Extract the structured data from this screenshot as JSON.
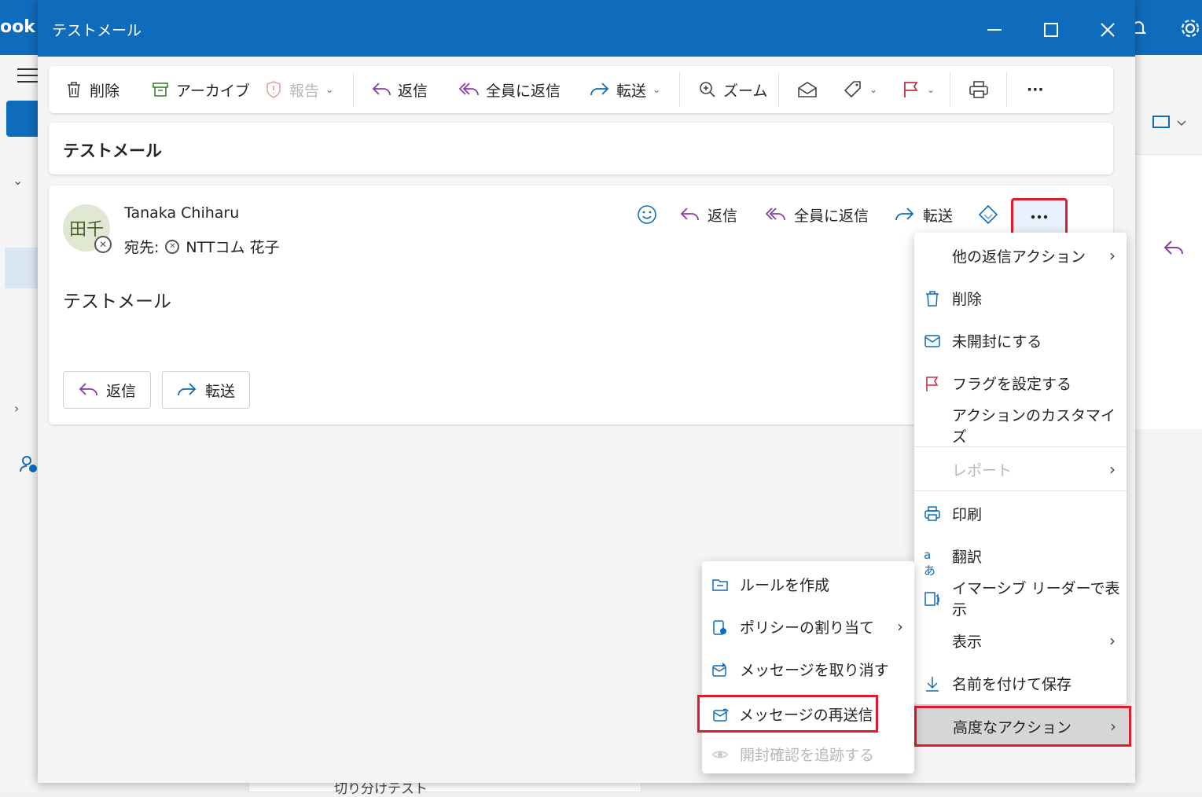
{
  "background": {
    "brand": "ook",
    "bottom_item": "切り分けテスト"
  },
  "window": {
    "title": "テストメール"
  },
  "toolbar": {
    "delete": "削除",
    "archive": "アーカイブ",
    "report": "報告",
    "reply": "返信",
    "reply_all": "全員に返信",
    "forward": "転送",
    "zoom": "ズーム",
    "more": "···"
  },
  "message": {
    "subject": "テストメール",
    "avatar_initials": "田千",
    "sender": "Tanaka Chiharu",
    "to_label": "宛先:",
    "recipient": "NTTコム 花子",
    "body": "テストメール",
    "actions": {
      "reply": "返信",
      "reply_all": "全員に返信",
      "forward": "転送"
    },
    "footer": {
      "reply": "返信",
      "forward": "転送"
    }
  },
  "menu": {
    "items": [
      {
        "label": "他の返信アクション",
        "icon": "none",
        "submenu": true
      },
      {
        "label": "削除",
        "icon": "trash-icon"
      },
      {
        "label": "未開封にする",
        "icon": "envelope-icon"
      },
      {
        "label": "フラグを設定する",
        "icon": "flag-icon"
      },
      {
        "label": "アクションのカスタマイズ",
        "icon": "none"
      },
      {
        "label": "レポート",
        "icon": "none",
        "submenu": true,
        "disabled": true
      },
      {
        "label": "印刷",
        "icon": "printer-icon"
      },
      {
        "label": "翻訳",
        "icon": "translate-icon"
      },
      {
        "label": "イマーシブ リーダーで表示",
        "icon": "immersive-reader-icon"
      },
      {
        "label": "表示",
        "icon": "none",
        "submenu": true
      },
      {
        "label": "名前を付けて保存",
        "icon": "download-icon"
      },
      {
        "label": "高度なアクション",
        "icon": "none",
        "submenu": true
      }
    ]
  },
  "submenu": {
    "items": [
      {
        "label": "ルールを作成",
        "icon": "rule-icon"
      },
      {
        "label": "ポリシーの割り当て",
        "icon": "policy-icon",
        "submenu": true
      },
      {
        "label": "メッセージを取り消す",
        "icon": "recall-icon"
      },
      {
        "label": "メッセージの再送信",
        "icon": "resend-icon"
      },
      {
        "label": "開封確認を追跡する",
        "icon": "eye-icon",
        "disabled": true
      }
    ]
  },
  "colors": {
    "brand": "#0f6cbd",
    "highlight": "#e21b2c",
    "reply_purple": "#8a3ca8",
    "flag_red": "#c4314b"
  }
}
